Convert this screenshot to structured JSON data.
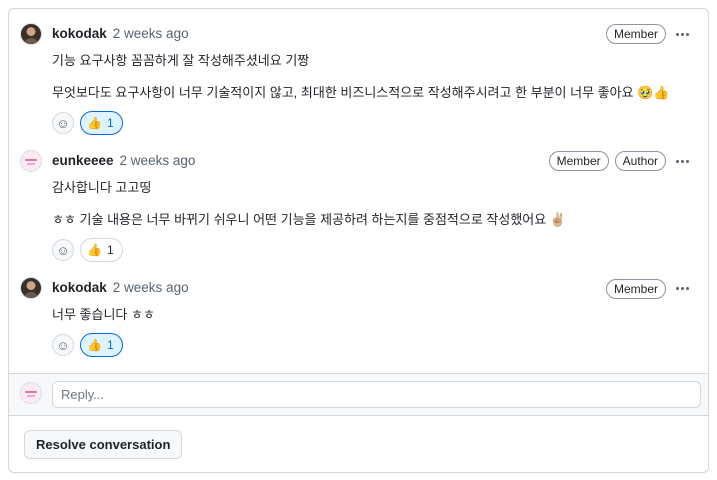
{
  "comments": [
    {
      "author": "kokodak",
      "time": "2 weeks ago",
      "labels": [
        "Member"
      ],
      "lines": [
        "기능 요구사항 꼼꼼하게 잘 작성해주셨네요 기짱",
        "무엇보다도 요구사항이 너무 기술적이지 않고, 최대한 비즈니스적으로 작성해주시려고 한 부분이 너무 좋아요 🥹👍"
      ],
      "reaction": {
        "emoji": "👍",
        "count": "1"
      }
    },
    {
      "author": "eunkeeee",
      "time": "2 weeks ago",
      "labels": [
        "Member",
        "Author"
      ],
      "lines": [
        "감사합니다 고고띵",
        "ㅎㅎ 기술 내용은 너무 바뀌기 쉬우니 어떤 기능을 제공하려 하는지를 중점적으로 작성했어요 ✌🏼"
      ],
      "reaction": {
        "emoji": "👍",
        "count": "1"
      }
    },
    {
      "author": "kokodak",
      "time": "2 weeks ago",
      "labels": [
        "Member"
      ],
      "lines": [
        "너무 좋습니다 ㅎㅎ"
      ],
      "reaction": {
        "emoji": "👍",
        "count": "1"
      }
    }
  ],
  "icons": {
    "emoji_picker": "smiley-icon",
    "more": "kebab-horizontal-icon"
  },
  "reply": {
    "placeholder": "Reply..."
  },
  "resolve_button": "Resolve conversation",
  "colors": {
    "accent": "#0969da",
    "reaction_active_bg": "#ddf4ff",
    "border": "#d0d7de"
  }
}
